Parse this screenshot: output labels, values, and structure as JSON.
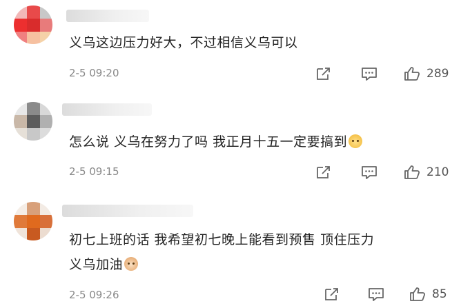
{
  "comments": [
    {
      "text": "义乌这边压力好大，不过相信义乌可以",
      "emoji": "",
      "date": "2-5 09:20",
      "likes": "289",
      "avatar_colors": [
        "#f2b8b8",
        "#e84a4a",
        "#c8c8c8",
        "#ec2f2f",
        "#d92c2c",
        "#e87b7b",
        "#f08080",
        "#f6c0a0",
        "#f5d2a8"
      ]
    },
    {
      "text": "怎么说 义乌在努力了吗 我正月十五一定要搞到",
      "emoji": "doge-emoji",
      "date": "2-5 09:15",
      "likes": "210",
      "avatar_colors": [
        "#e8e8e8",
        "#8a8a8a",
        "#d8d8d8",
        "#c9b8a8",
        "#5c5c5c",
        "#b0b0b0",
        "#e6e0d8",
        "#c8c8c8",
        "#dcdcdc"
      ]
    },
    {
      "text": "初七上班的话 我希望初七晚上能看到预售 顶住压力\n义乌加油",
      "emoji": "cat-emoji",
      "date": "2-5 09:26",
      "likes": "85",
      "avatar_colors": [
        "#f5ede6",
        "#d8a07a",
        "#f3ebe4",
        "#e07a3a",
        "#e06a1e",
        "#d8703a",
        "#f0e4da",
        "#c85a20",
        "#ecdcd0"
      ]
    }
  ],
  "icons": {
    "share": "share-icon",
    "reply": "reply-icon",
    "like": "like-icon"
  }
}
